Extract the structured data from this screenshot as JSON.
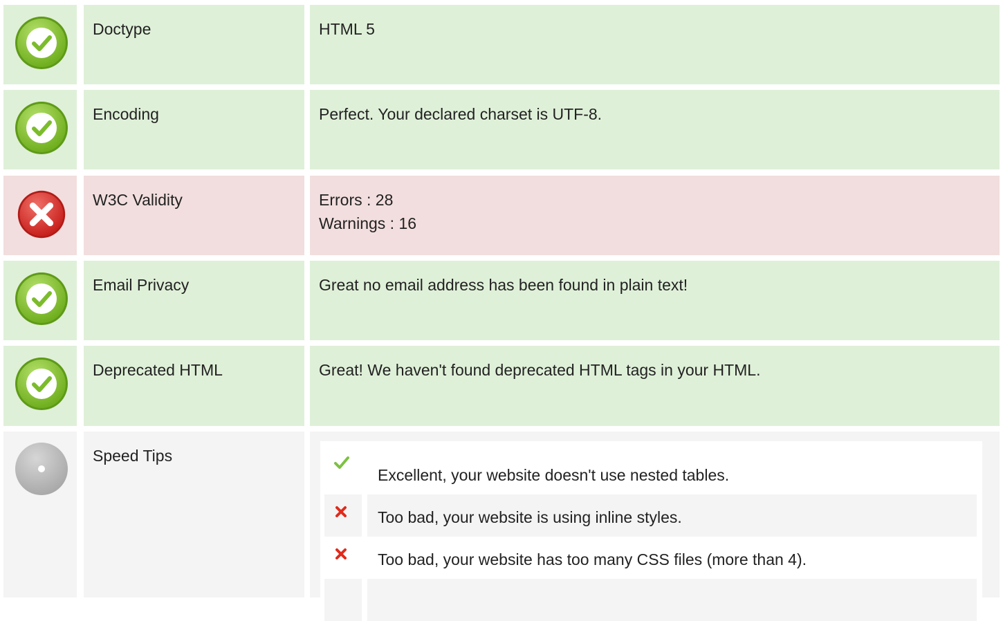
{
  "colors": {
    "pass_bg": "#dff0d8",
    "fail_bg": "#f2dede",
    "neutral_bg": "#f4f4f4",
    "pass_icon": "#8dc63f",
    "fail_icon": "#e0413d",
    "neutral_icon": "#b5b5b6"
  },
  "rows": [
    {
      "status": "pass",
      "icon": "check-circle-icon",
      "label": "Doctype",
      "value_lines": [
        "HTML 5"
      ]
    },
    {
      "status": "pass",
      "icon": "check-circle-icon",
      "label": "Encoding",
      "value_lines": [
        "Perfect. Your declared charset is UTF-8."
      ]
    },
    {
      "status": "fail",
      "icon": "cross-circle-icon",
      "label": "W3C Validity",
      "value_lines": [
        "Errors : 28",
        "Warnings : 16"
      ]
    },
    {
      "status": "pass",
      "icon": "check-circle-icon",
      "label": "Email Privacy",
      "value_lines": [
        "Great no email address has been found in plain text!"
      ]
    },
    {
      "status": "pass",
      "icon": "check-circle-icon",
      "label": "Deprecated HTML",
      "value_lines": [
        "Great! We haven't found deprecated HTML tags in your HTML."
      ]
    }
  ],
  "speed_tips": {
    "label": "Speed Tips",
    "icon": "info-circle-icon",
    "tips": [
      {
        "status": "pass",
        "icon": "checkmark-icon",
        "text": "Excellent, your website doesn't use nested tables."
      },
      {
        "status": "fail",
        "icon": "x-mark-icon",
        "text": "Too bad, your website is using inline styles."
      },
      {
        "status": "fail",
        "icon": "x-mark-icon",
        "text": "Too bad, your website has too many CSS files (more than 4)."
      }
    ]
  }
}
